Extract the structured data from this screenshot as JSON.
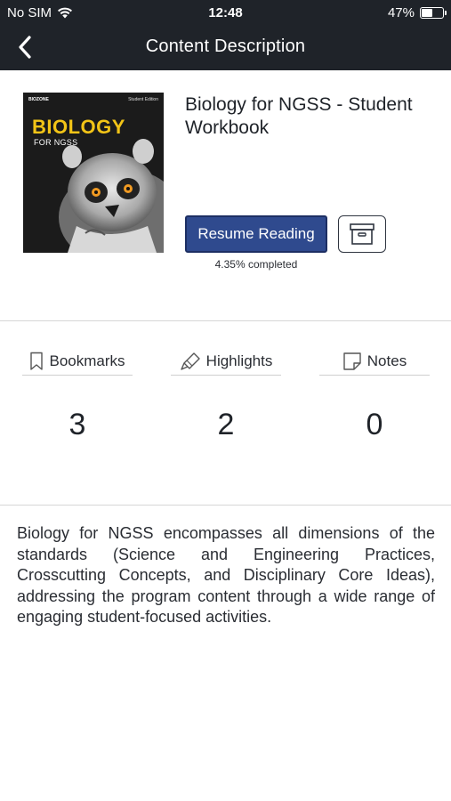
{
  "status_bar": {
    "carrier": "No SIM",
    "time": "12:48",
    "battery_percent": "47%",
    "battery_level": 0.47
  },
  "nav": {
    "title": "Content Description",
    "back_icon": "chevron-left-icon"
  },
  "book": {
    "cover": {
      "publisher": "BIOZONE",
      "edition": "Student Edition",
      "title": "BIOLOGY",
      "subtitle": "FOR NGSS"
    },
    "title": "Biology for NGSS - Student Workbook",
    "resume_label": "Resume Reading",
    "archive_icon": "archive-box-icon",
    "progress_text": "4.35% completed",
    "progress_value": 0.0435
  },
  "stats": [
    {
      "label": "Bookmarks",
      "icon": "bookmark-icon",
      "value": "3"
    },
    {
      "label": "Highlights",
      "icon": "highlighter-icon",
      "value": "2"
    },
    {
      "label": "Notes",
      "icon": "note-icon",
      "value": "0"
    }
  ],
  "description": "Biology for NGSS encompasses all dimensions of the standards (Science and Engineering Practices, Crosscutting Concepts, and Disciplinary Core Ideas), addressing the program content through a wide range of engaging student-focused activities.",
  "colors": {
    "header_bg": "#1f2329",
    "accent": "#2f4a8e",
    "cover_title": "#f2c417"
  }
}
